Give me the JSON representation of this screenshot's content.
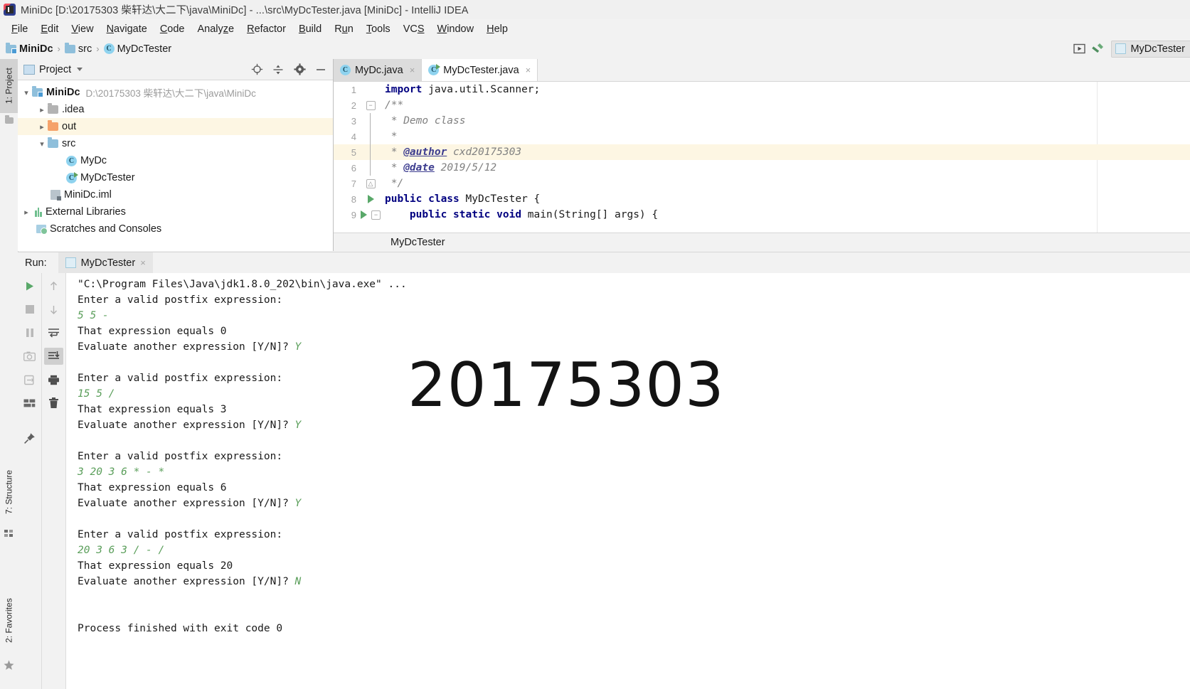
{
  "window": {
    "title": "MiniDc [D:\\20175303 柴轩达\\大二下\\java\\MiniDc] - ...\\src\\MyDcTester.java [MiniDc] - IntelliJ IDEA",
    "app_icon": "intellij-idea-icon"
  },
  "menubar": {
    "items": [
      {
        "label": "File"
      },
      {
        "label": "Edit"
      },
      {
        "label": "View"
      },
      {
        "label": "Navigate"
      },
      {
        "label": "Code"
      },
      {
        "label": "Analyze"
      },
      {
        "label": "Refactor"
      },
      {
        "label": "Build"
      },
      {
        "label": "Run"
      },
      {
        "label": "Tools"
      },
      {
        "label": "VCS"
      },
      {
        "label": "Window"
      },
      {
        "label": "Help"
      }
    ]
  },
  "navbar": {
    "crumbs": [
      {
        "label": "MiniDc",
        "icon": "module-folder-icon"
      },
      {
        "label": "src",
        "icon": "source-folder-icon"
      },
      {
        "label": "MyDcTester",
        "icon": "java-class-icon"
      }
    ],
    "separator": "›",
    "actions": [
      {
        "name": "run-icon",
        "label": ""
      },
      {
        "name": "build-hammer-icon",
        "label": ""
      }
    ],
    "run_configuration": "MyDcTester"
  },
  "toolstrip": {
    "items": [
      {
        "label": "1: Project",
        "icon": "project-icon",
        "selected": true
      },
      {
        "label": "7: Structure",
        "icon": "structure-icon",
        "selected": false
      },
      {
        "label": "2: Favorites",
        "icon": "favorites-star-icon",
        "selected": false
      }
    ]
  },
  "project_panel": {
    "title": "Project",
    "toolbar": [
      {
        "name": "locate-target-icon"
      },
      {
        "name": "collapse-all-icon"
      },
      {
        "name": "gear-settings-icon"
      },
      {
        "name": "hide-minimize-icon"
      }
    ],
    "tree": [
      {
        "label": "MiniDc",
        "sub": "D:\\20175303 柴轩达\\大二下\\java\\MiniDc",
        "icon": "module-folder-icon",
        "arrow": "expanded",
        "indent": 0,
        "bold": true,
        "highlight": false
      },
      {
        "label": ".idea",
        "sub": "",
        "icon": "grey-folder-icon",
        "arrow": "collapsed",
        "indent": 1,
        "bold": false,
        "highlight": false
      },
      {
        "label": "out",
        "sub": "",
        "icon": "orange-folder-icon",
        "arrow": "collapsed",
        "indent": 1,
        "bold": false,
        "highlight": true
      },
      {
        "label": "src",
        "sub": "",
        "icon": "source-folder-icon",
        "arrow": "expanded",
        "indent": 1,
        "bold": false,
        "highlight": false
      },
      {
        "label": "MyDc",
        "sub": "",
        "icon": "java-class-icon",
        "arrow": "none",
        "indent": 2,
        "bold": false,
        "highlight": false
      },
      {
        "label": "MyDcTester",
        "sub": "",
        "icon": "java-runnable-class-icon",
        "arrow": "none",
        "indent": 2,
        "bold": false,
        "highlight": false
      },
      {
        "label": "MiniDc.iml",
        "sub": "",
        "icon": "iml-file-icon",
        "arrow": "none",
        "indent": 1,
        "bold": false,
        "highlight": false
      },
      {
        "label": "External Libraries",
        "sub": "",
        "icon": "libraries-icon",
        "arrow": "collapsed",
        "indent": 0,
        "bold": false,
        "highlight": false
      },
      {
        "label": "Scratches and Consoles",
        "sub": "",
        "icon": "scratches-icon",
        "arrow": "none",
        "indent": 0,
        "bold": false,
        "highlight": false
      }
    ]
  },
  "editor": {
    "tabs": [
      {
        "label": "MyDc.java",
        "icon": "java-class-icon",
        "active": false
      },
      {
        "label": "MyDcTester.java",
        "icon": "java-runnable-class-icon",
        "active": true
      }
    ],
    "close_glyph": "×",
    "lines": [
      {
        "num": "1",
        "gutter": "none",
        "fold": "none",
        "highlight": false,
        "segments": [
          {
            "t": "import",
            "c": "kw"
          },
          {
            "t": " java.util.Scanner;",
            "c": ""
          }
        ]
      },
      {
        "num": "2",
        "gutter": "none",
        "fold": "minus",
        "highlight": false,
        "segments": [
          {
            "t": "/**",
            "c": "cmt"
          }
        ]
      },
      {
        "num": "3",
        "gutter": "none",
        "fold": "none",
        "highlight": false,
        "segments": [
          {
            "t": " * Demo class",
            "c": "cmt"
          }
        ]
      },
      {
        "num": "4",
        "gutter": "none",
        "fold": "none",
        "highlight": false,
        "segments": [
          {
            "t": " *",
            "c": "cmt"
          }
        ]
      },
      {
        "num": "5",
        "gutter": "none",
        "fold": "none",
        "highlight": true,
        "segments": [
          {
            "t": " * ",
            "c": "cmt"
          },
          {
            "t": "@author",
            "c": "doctag"
          },
          {
            "t": " cxd20175303",
            "c": "docval"
          }
        ]
      },
      {
        "num": "6",
        "gutter": "none",
        "fold": "none",
        "highlight": false,
        "segments": [
          {
            "t": " * ",
            "c": "cmt"
          },
          {
            "t": "@date",
            "c": "doctag"
          },
          {
            "t": " 2019/5/12",
            "c": "docval"
          }
        ]
      },
      {
        "num": "7",
        "gutter": "none",
        "fold": "plus",
        "highlight": false,
        "segments": [
          {
            "t": " */",
            "c": "cmt"
          }
        ]
      },
      {
        "num": "8",
        "gutter": "run",
        "fold": "none",
        "highlight": false,
        "segments": [
          {
            "t": "public class",
            "c": "kw"
          },
          {
            "t": " MyDcTester {",
            "c": ""
          }
        ]
      },
      {
        "num": "9",
        "gutter": "run",
        "fold": "minus",
        "highlight": false,
        "segments": [
          {
            "t": "    public static void",
            "c": "kw"
          },
          {
            "t": " main(String[] args) {",
            "c": ""
          }
        ]
      }
    ],
    "breadcrumb": "MyDcTester"
  },
  "run_panel": {
    "label": "Run:",
    "tab": "MyDcTester",
    "close_glyph": "×",
    "toolbar_left": [
      {
        "name": "rerun-play-icon",
        "selected": false
      },
      {
        "name": "stop-icon",
        "selected": false
      },
      {
        "name": "pause-icon",
        "selected": false
      },
      {
        "name": "screenshot-camera-icon",
        "selected": false
      },
      {
        "name": "dump-threads-icon",
        "selected": false
      },
      {
        "name": "layout-icon",
        "selected": false
      },
      {
        "name": "pin-tab-icon",
        "selected": false
      }
    ],
    "toolbar_right": [
      {
        "name": "up-arrow-icon",
        "selected": false
      },
      {
        "name": "down-arrow-icon",
        "selected": false
      },
      {
        "name": "soft-wrap-icon",
        "selected": false
      },
      {
        "name": "scroll-to-end-icon",
        "selected": true
      },
      {
        "name": "print-icon",
        "selected": false
      },
      {
        "name": "clear-all-trash-icon",
        "selected": false
      }
    ],
    "console_lines": [
      {
        "text": "\"C:\\Program Files\\Java\\jdk1.8.0_202\\bin\\java.exe\" ...",
        "style": "cmd"
      },
      {
        "text": "Enter a valid postfix expression:",
        "style": "out"
      },
      {
        "text": "5 5 -",
        "style": "in"
      },
      {
        "text": "That expression equals 0",
        "style": "out"
      },
      {
        "text": "Evaluate another expression [Y/N]? ",
        "style": "out",
        "input": "Y"
      },
      {
        "text": "",
        "style": "out"
      },
      {
        "text": "Enter a valid postfix expression:",
        "style": "out"
      },
      {
        "text": "15 5 /",
        "style": "in"
      },
      {
        "text": "That expression equals 3",
        "style": "out"
      },
      {
        "text": "Evaluate another expression [Y/N]? ",
        "style": "out",
        "input": "Y"
      },
      {
        "text": "",
        "style": "out"
      },
      {
        "text": "Enter a valid postfix expression:",
        "style": "out"
      },
      {
        "text": "3 20 3 6 * - *",
        "style": "in"
      },
      {
        "text": "That expression equals 6",
        "style": "out"
      },
      {
        "text": "Evaluate another expression [Y/N]? ",
        "style": "out",
        "input": "Y"
      },
      {
        "text": "",
        "style": "out"
      },
      {
        "text": "Enter a valid postfix expression:",
        "style": "out"
      },
      {
        "text": "20 3 6 3 / - /",
        "style": "in"
      },
      {
        "text": "That expression equals 20",
        "style": "out"
      },
      {
        "text": "Evaluate another expression [Y/N]? ",
        "style": "out",
        "input": "N"
      },
      {
        "text": "",
        "style": "out"
      },
      {
        "text": "",
        "style": "out"
      },
      {
        "text": "Process finished with exit code 0",
        "style": "out"
      }
    ],
    "watermark": "20175303"
  },
  "colors": {
    "accent_green": "#59a869",
    "highlight_yellow": "#fdf6e3",
    "panel_bg": "#f2f2f2",
    "keyword_blue": "#000080",
    "comment_grey": "#808080",
    "console_input_green": "#5a9e5a"
  }
}
